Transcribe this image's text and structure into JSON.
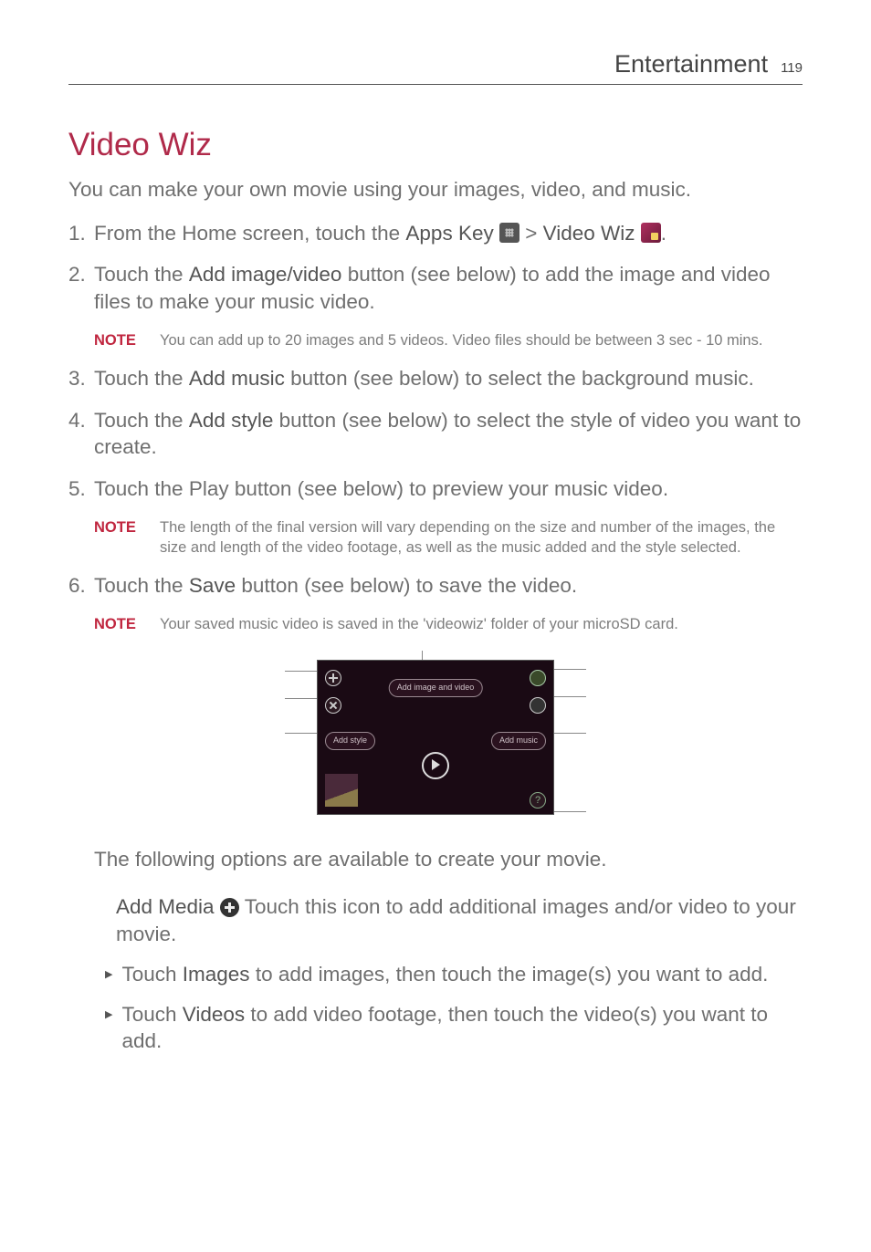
{
  "header": {
    "section": "Entertainment",
    "page": "119"
  },
  "h1": "Video Wiz",
  "intro": "You can make your own movie using your images, video, and music.",
  "steps": {
    "s1": {
      "num": "1.",
      "p1": "From the Home screen, touch the ",
      "b1": "Apps Key",
      "p2": " ",
      "gt": " > ",
      "b2": "Video Wiz",
      "p3": " ",
      "end": "."
    },
    "s2": {
      "num": "2.",
      "p1": "Touch the ",
      "b1": "Add image/video",
      "p2": " button (see      below) to add the image and video files to make your music video."
    },
    "s3": {
      "num": "3.",
      "p1": "Touch the ",
      "b1": "Add music",
      "p2": " button (see      below) to select the background music."
    },
    "s4": {
      "num": "4.",
      "p1": "Touch the ",
      "b1": "Add style",
      "p2": " button (see      below) to select the style of video you want to create."
    },
    "s5": {
      "num": "5.",
      "p1": "Touch the Play button (see      below) to preview your music video."
    },
    "s6": {
      "num": "6.",
      "p1": "Touch the ",
      "b1": "Save",
      "p2": " button (see      below) to save the video."
    }
  },
  "notes": {
    "label": "NOTE",
    "n1": "You can add up to 20 images and 5 videos. Video files should be between 3 sec - 10 mins.",
    "n2": "The length of the final version will vary depending on the size and number of the images, the size and length of the video footage, as well as the music added and the style selected.",
    "n3": "Your saved music video is saved in the 'videowiz' folder of your microSD card."
  },
  "screenshot": {
    "add_image_and_video": "Add image and video",
    "add_style": "Add style",
    "add_music": "Add music",
    "help": "?"
  },
  "after": {
    "options_intro": "The following options are available to create your movie.",
    "add_media_label": "Add Media",
    "add_media_rest": " Touch this icon to add additional images and/or video to your movie.",
    "bullet_images_b": "Images",
    "bullet_images_p1": "Touch ",
    "bullet_images_p2": " to add images, then touch the image(s) you want to add.",
    "bullet_videos_b": "Videos",
    "bullet_videos_p1": "Touch ",
    "bullet_videos_p2": " to add video footage, then touch the video(s) you want to add."
  }
}
